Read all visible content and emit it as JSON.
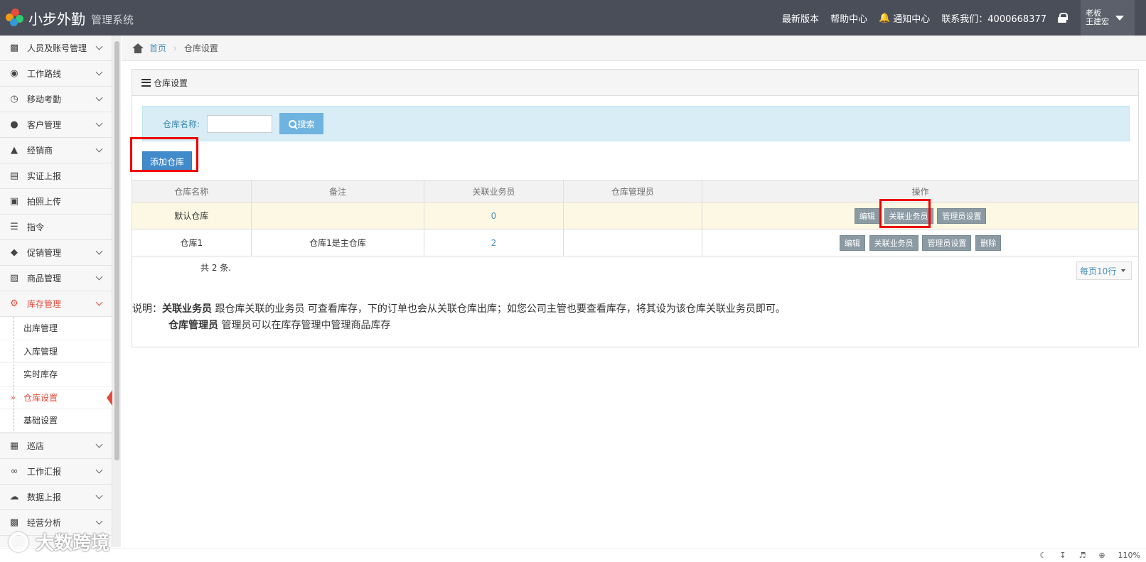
{
  "header": {
    "brand": "小步外勤",
    "subtitle": "管理系统",
    "links": [
      "最新版本",
      "帮助中心",
      "通知中心",
      "联系我们：4000668377"
    ],
    "user_role": "老板",
    "user_name": "王建宏"
  },
  "sidebar": {
    "items": [
      {
        "label": "人员及账号管理",
        "icon": "sitemap-icon"
      },
      {
        "label": "工作路线",
        "icon": "map-marker-icon"
      },
      {
        "label": "移动考勤",
        "icon": "clock-icon"
      },
      {
        "label": "客户管理",
        "icon": "user-icon"
      },
      {
        "label": "经销商",
        "icon": "dealer-icon"
      },
      {
        "label": "实证上报",
        "icon": "file-icon"
      },
      {
        "label": "拍照上传",
        "icon": "camera-icon"
      },
      {
        "label": "指令",
        "icon": "tasks-icon"
      },
      {
        "label": "促销管理",
        "icon": "tag-icon"
      },
      {
        "label": "商品管理",
        "icon": "truck-icon"
      },
      {
        "label": "库存管理",
        "icon": "cogs-icon"
      }
    ],
    "inventory_sub": [
      "出库管理",
      "入库管理",
      "实时库存",
      "仓库设置",
      "基础设置"
    ],
    "items_after": [
      {
        "label": "巡店",
        "icon": "calendar-icon"
      },
      {
        "label": "工作汇报",
        "icon": "paperclip-icon"
      },
      {
        "label": "数据上报",
        "icon": "cloud-upload-icon"
      },
      {
        "label": "经营分析",
        "icon": "chart-icon"
      }
    ]
  },
  "breadcrumb": {
    "home": "首页",
    "current": "仓库设置"
  },
  "panel": {
    "title": "仓库设置",
    "search_label": "仓库名称:",
    "search_value": "",
    "search_button": "搜索",
    "add_button": "添加仓库"
  },
  "table": {
    "headers": [
      "仓库名称",
      "备注",
      "关联业务员",
      "仓库管理员",
      "操作"
    ],
    "rows": [
      {
        "name": "默认仓库",
        "remark": "",
        "salesmen": "0",
        "admin": "",
        "ops": [
          "编辑",
          "关联业务员",
          "管理员设置"
        ]
      },
      {
        "name": "仓库1",
        "remark": "仓库1是主仓库",
        "salesmen": "2",
        "admin": "",
        "ops": [
          "编辑",
          "关联业务员",
          "管理员设置",
          "删除"
        ]
      }
    ]
  },
  "footer": {
    "total": "共 2 条.",
    "per_page": "每页10行"
  },
  "note": {
    "prefix": "说明：",
    "term1": "关联业务员",
    "desc1": "跟仓库关联的业务员 可查看库存，下的订单也会从关联仓库出库；如您公司主管也要查看库存，将其设为该仓库关联业务员即可。",
    "term2": "仓库管理员",
    "desc2": "管理员可以在库存管理中管理商品库存"
  },
  "status": {
    "zoom": "110%"
  },
  "watermark": "大数跨境",
  "colors": {
    "active": "#e24c3c",
    "link": "#4c8fbd",
    "topbar": "#4a4e59"
  }
}
